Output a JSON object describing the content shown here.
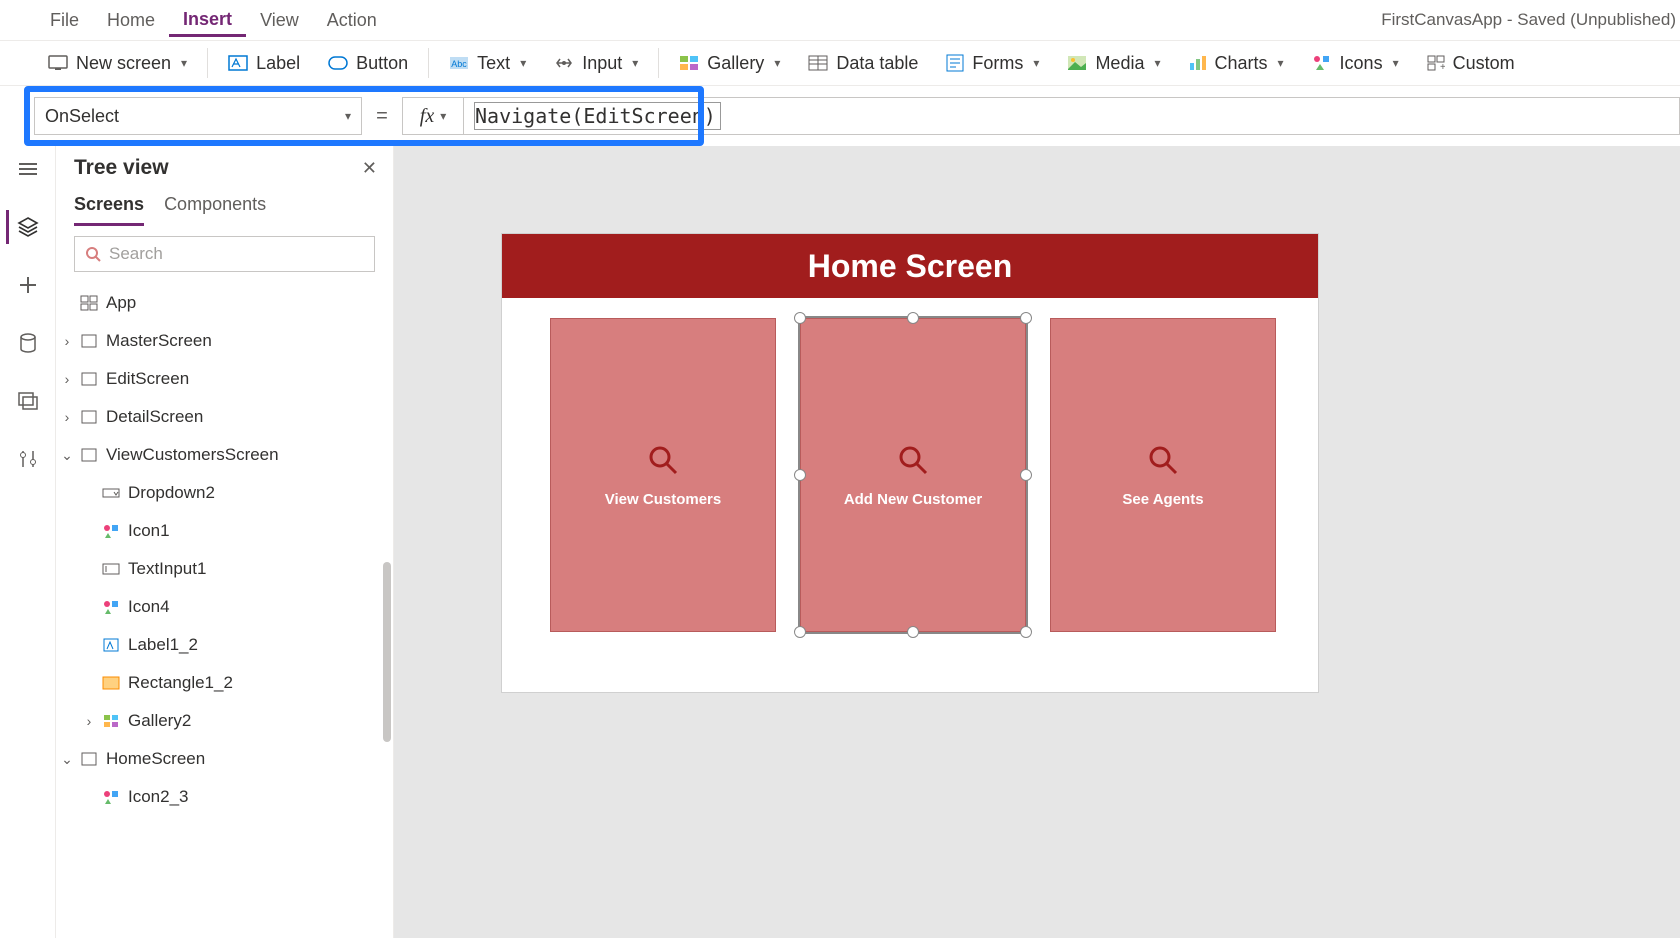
{
  "menubar": {
    "file": "File",
    "home": "Home",
    "insert": "Insert",
    "view": "View",
    "action": "Action",
    "app_title": "FirstCanvasApp - Saved (Unpublished)"
  },
  "ribbon": {
    "new_screen": "New screen",
    "label": "Label",
    "button": "Button",
    "text": "Text",
    "input": "Input",
    "gallery": "Gallery",
    "data_table": "Data table",
    "forms": "Forms",
    "media": "Media",
    "charts": "Charts",
    "icons": "Icons",
    "custom": "Custom"
  },
  "formula": {
    "property": "OnSelect",
    "equals": "=",
    "fx": "fx",
    "expression": "Navigate(EditScreen)"
  },
  "treepanel": {
    "title": "Tree view",
    "tabs": {
      "screens": "Screens",
      "components": "Components"
    },
    "search_placeholder": "Search",
    "nodes": {
      "app": "App",
      "master": "MasterScreen",
      "edit": "EditScreen",
      "detail": "DetailScreen",
      "viewcust": "ViewCustomersScreen",
      "dropdown2": "Dropdown2",
      "icon1": "Icon1",
      "textinput1": "TextInput1",
      "icon4": "Icon4",
      "label1_2": "Label1_2",
      "rectangle1_2": "Rectangle1_2",
      "gallery2": "Gallery2",
      "homescreen": "HomeScreen",
      "icon2_3": "Icon2_3"
    }
  },
  "canvas": {
    "screen_title": "Home Screen",
    "cards": {
      "view_customers": "View Customers",
      "add_new_customer": "Add New Customer",
      "see_agents": "See Agents"
    }
  }
}
